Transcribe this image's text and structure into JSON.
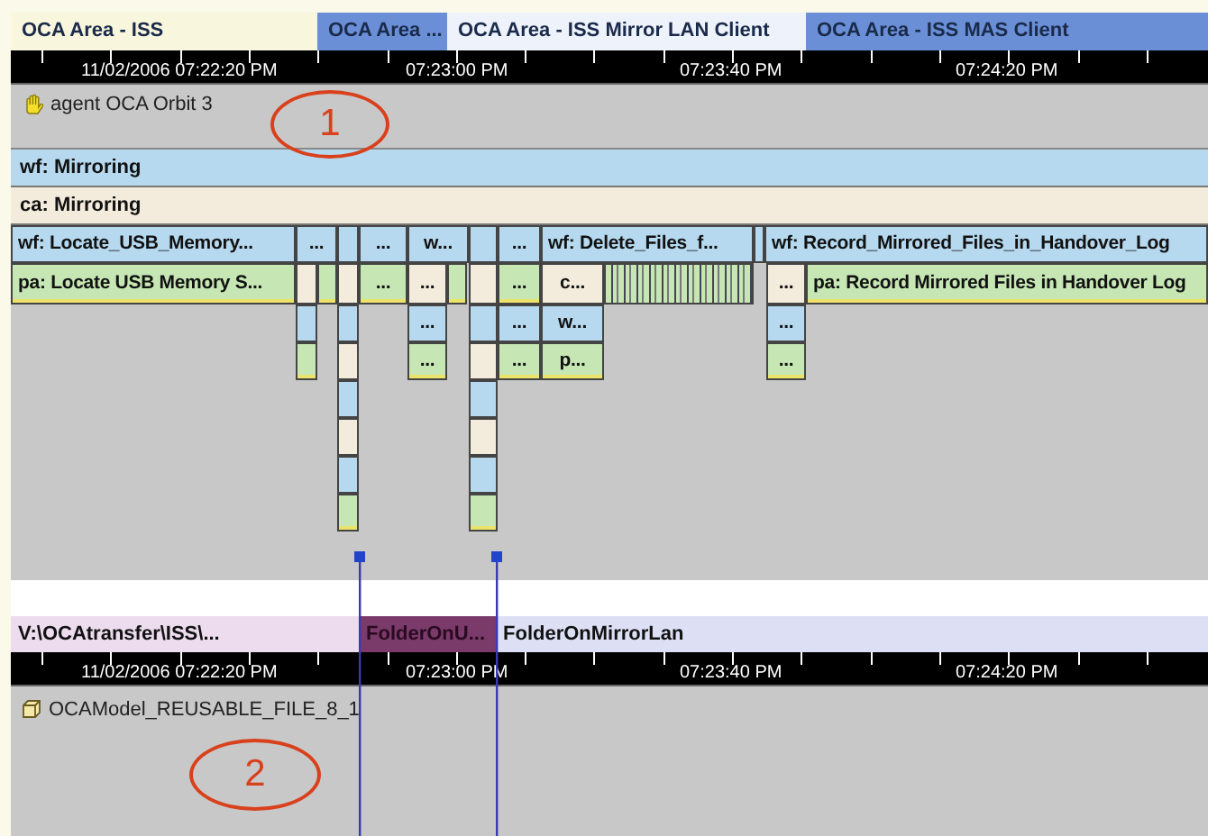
{
  "tabs": [
    {
      "label": "OCA Area - ISS",
      "color": "#f8f6dc"
    },
    {
      "label": "OCA Area ...",
      "color": "#6a8fd6"
    },
    {
      "label": "OCA Area - ISS Mirror LAN Client",
      "color": "#eef2fb"
    },
    {
      "label": "OCA Area - ISS MAS Client",
      "color": "#6a8fd6"
    }
  ],
  "upper_ruler": {
    "labels": [
      "11/02/2006 07:22:20 PM",
      "07:23:00 PM",
      "07:23:40 PM",
      "07:24:20 PM"
    ]
  },
  "agent": {
    "label": "agent OCA Orbit 3"
  },
  "bands": [
    {
      "kind": "wf",
      "label": "wf: Mirroring"
    },
    {
      "kind": "ca",
      "label": "ca: Mirroring"
    }
  ],
  "wf_row": [
    {
      "kind": "wf",
      "label": "wf: Locate_USB_Memory..."
    },
    {
      "kind": "wf",
      "label": "..."
    },
    {
      "kind": "wf"
    },
    {
      "kind": "wf",
      "label": "..."
    },
    {
      "kind": "wf",
      "label": "w..."
    },
    {
      "kind": "wf"
    },
    {
      "kind": "wf",
      "label": "..."
    },
    {
      "kind": "wf",
      "label": "wf: Delete_Files_f..."
    },
    {
      "kind": "wf"
    },
    {
      "kind": "wf",
      "label": "wf: Record_Mirrored_Files_in_Handover_Log"
    }
  ],
  "pa_row": [
    {
      "kind": "pa",
      "label": "pa: Locate USB Memory S..."
    },
    {
      "kind": "ca"
    },
    {
      "kind": "pa"
    },
    {
      "kind": "ca"
    },
    {
      "kind": "pa",
      "label": "..."
    },
    {
      "kind": "ca",
      "label": "..."
    },
    {
      "kind": "pa"
    },
    {
      "kind": "ca"
    },
    {
      "kind": "pa",
      "label": "..."
    },
    {
      "kind": "ca",
      "label": "c..."
    },
    {
      "kind": "hatched"
    },
    {
      "kind": "ca",
      "label": "..."
    },
    {
      "kind": "pa",
      "label": "pa: Record Mirrored Files in Handover Log"
    }
  ],
  "stacks": [
    {
      "cells": [
        {
          "kind": "wf"
        },
        {
          "kind": "pa"
        }
      ]
    },
    {
      "cells": [
        {
          "kind": "wf"
        },
        {
          "kind": "ca"
        },
        {
          "kind": "wf"
        },
        {
          "kind": "ca"
        },
        {
          "kind": "wf"
        },
        {
          "kind": "pa"
        }
      ]
    },
    {
      "cells": [
        {
          "kind": "wf",
          "label": "..."
        },
        {
          "kind": "pa",
          "label": "..."
        }
      ]
    },
    {
      "cells": [
        {
          "kind": "wf"
        },
        {
          "kind": "ca"
        },
        {
          "kind": "wf"
        },
        {
          "kind": "ca"
        },
        {
          "kind": "wf"
        },
        {
          "kind": "pa"
        }
      ]
    },
    {
      "cells": [
        {
          "kind": "wf",
          "label": "..."
        },
        {
          "kind": "pa",
          "label": "..."
        }
      ]
    },
    {
      "cells": [
        {
          "kind": "wf",
          "label": "w..."
        },
        {
          "kind": "pa",
          "label": "p..."
        }
      ]
    },
    {
      "cells": [
        {
          "kind": "wf",
          "label": "..."
        },
        {
          "kind": "pa",
          "label": "..."
        }
      ]
    }
  ],
  "path_bar": [
    {
      "label": "V:\\OCAtransfer\\ISS\\...",
      "color": "#ecdcee"
    },
    {
      "label": "FolderOnU...",
      "color": "#7a3a6a"
    },
    {
      "label": "FolderOnMirrorLan",
      "color": "#dde0f5"
    }
  ],
  "lower_ruler": {
    "labels": [
      "11/02/2006 07:22:20 PM",
      "07:23:00 PM",
      "07:23:40 PM",
      "07:24:20 PM"
    ]
  },
  "file": {
    "label": "OCAModel_REUSABLE_FILE_8_1"
  },
  "callouts": [
    {
      "label": "1"
    },
    {
      "label": "2"
    }
  ]
}
